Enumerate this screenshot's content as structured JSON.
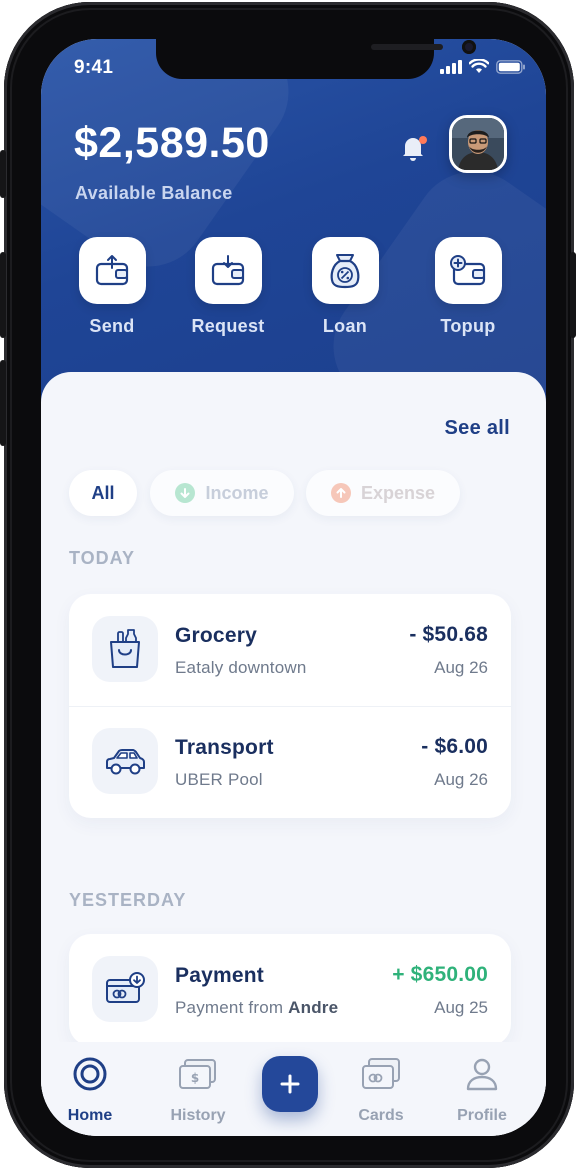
{
  "status_bar": {
    "time": "9:41"
  },
  "header": {
    "balance": "$2,589.50",
    "balance_label": "Available Balance"
  },
  "actions": [
    {
      "label": "Send",
      "icon": "wallet-send-icon"
    },
    {
      "label": "Request",
      "icon": "wallet-request-icon"
    },
    {
      "label": "Loan",
      "icon": "money-bag-percent-icon"
    },
    {
      "label": "Topup",
      "icon": "wallet-topup-icon"
    }
  ],
  "transactions_header": {
    "see_all": "See all"
  },
  "filters": [
    {
      "label": "All",
      "active": true
    },
    {
      "label": "Income",
      "active": false
    },
    {
      "label": "Expense",
      "active": false
    }
  ],
  "sections": [
    {
      "label": "TODAY",
      "items": [
        {
          "title": "Grocery",
          "subtitle": "Eataly downtown",
          "amount": "- $50.68",
          "date": "Aug 26",
          "icon": "grocery-bag-icon"
        },
        {
          "title": "Transport",
          "subtitle": "UBER Pool",
          "amount": "- $6.00",
          "date": "Aug 26",
          "icon": "car-icon"
        }
      ]
    },
    {
      "label": "YESTERDAY",
      "items": [
        {
          "title": "Payment",
          "subtitle_prefix": "Payment from ",
          "subtitle_name": "Andre",
          "amount": "+ $650.00",
          "date": "Aug 25",
          "icon": "card-receive-icon"
        }
      ]
    }
  ],
  "bottom_nav": [
    {
      "label": "Home",
      "active": true
    },
    {
      "label": "History",
      "active": false
    },
    {
      "label": "Cards",
      "active": false
    },
    {
      "label": "Profile",
      "active": false
    }
  ],
  "colors": {
    "header_blue": "#1f4596",
    "primary_text": "#1a2f5f",
    "positive": "#2fb27a",
    "income_chip": "#9fdcc0",
    "expense_chip": "#f3b8a8"
  }
}
